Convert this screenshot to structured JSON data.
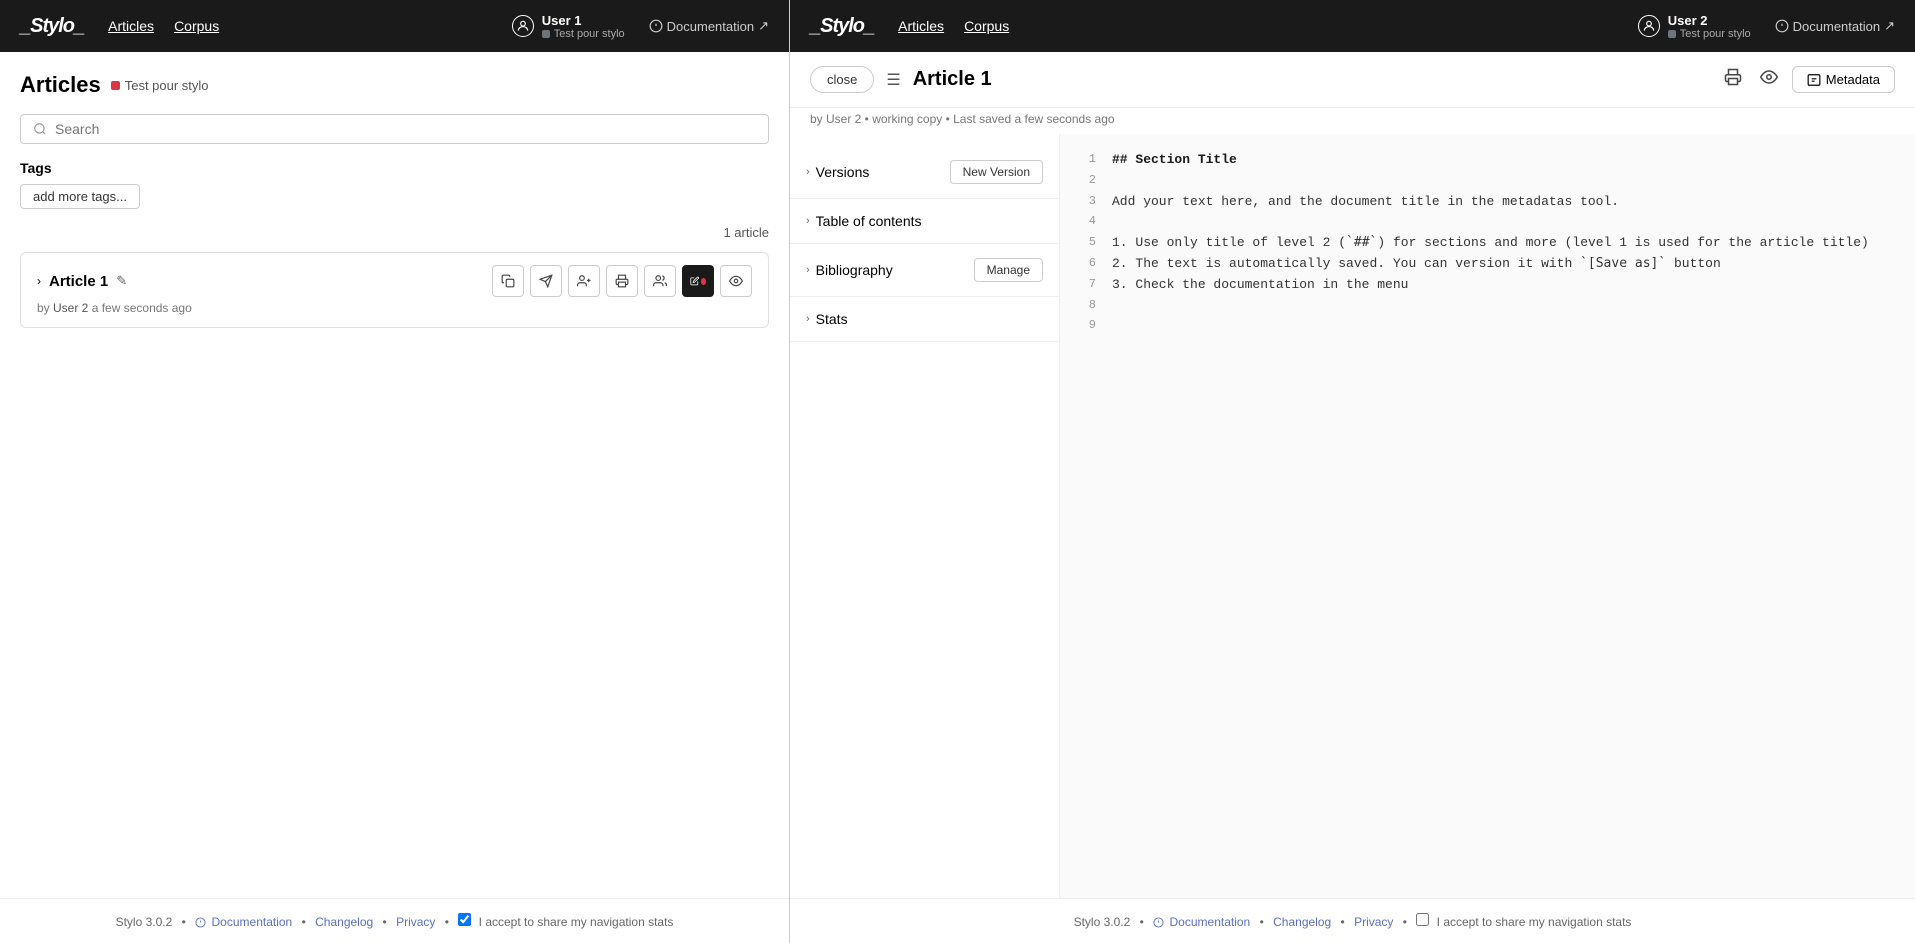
{
  "leftPanel": {
    "navbar": {
      "brand": "_Stylo_",
      "nav": [
        {
          "label": "Articles",
          "id": "articles"
        },
        {
          "label": "Corpus",
          "id": "corpus"
        }
      ],
      "user": {
        "name": "User 1",
        "corpusName": "Test pour stylo"
      },
      "documentation": "Documentation"
    },
    "pageTitle": "Articles",
    "corpusBadge": "Test pour stylo",
    "search": {
      "placeholder": "Search",
      "value": ""
    },
    "tags": {
      "label": "Tags",
      "addButton": "add more tags..."
    },
    "articleCount": "1 article",
    "articles": [
      {
        "id": "article-1",
        "title": "Article 1",
        "author": "User 2",
        "timestamp": "a few seconds ago",
        "actions": [
          {
            "id": "copy",
            "icon": "⧉",
            "label": "copy"
          },
          {
            "id": "send",
            "icon": "✈",
            "label": "send"
          },
          {
            "id": "add-user",
            "icon": "⊕",
            "label": "add user"
          },
          {
            "id": "print",
            "icon": "⎙",
            "label": "print"
          },
          {
            "id": "share",
            "icon": "👥",
            "label": "share"
          },
          {
            "id": "edit",
            "icon": "✏",
            "label": "edit",
            "active": true
          },
          {
            "id": "preview",
            "icon": "👁",
            "label": "preview"
          }
        ]
      }
    ],
    "footer": {
      "version": "Stylo 3.0.2",
      "documentation": "Documentation",
      "changelog": "Changelog",
      "privacy": "Privacy",
      "statsConsent": "I accept to share my navigation stats"
    }
  },
  "rightPanel": {
    "navbar": {
      "brand": "_Stylo_",
      "nav": [
        {
          "label": "Articles",
          "id": "articles"
        },
        {
          "label": "Corpus",
          "id": "corpus"
        }
      ],
      "user": {
        "name": "User 2",
        "corpusName": "Test pour stylo"
      },
      "documentation": "Documentation"
    },
    "editor": {
      "closeButton": "close",
      "articleTitle": "Article 1",
      "subtitle": "by User 2  •  working copy  •  Last saved a few seconds ago",
      "metadataButton": "Metadata",
      "sidebar": {
        "sections": [
          {
            "id": "versions",
            "title": "Versions",
            "actionButton": "New Version"
          },
          {
            "id": "table-of-contents",
            "title": "Table of contents",
            "actionButton": null
          },
          {
            "id": "bibliography",
            "title": "Bibliography",
            "actionButton": "Manage"
          },
          {
            "id": "stats",
            "title": "Stats",
            "actionButton": null
          }
        ]
      },
      "codeLines": [
        {
          "num": "1",
          "content": "## Section Title",
          "type": "h2"
        },
        {
          "num": "2",
          "content": "",
          "type": "empty"
        },
        {
          "num": "3",
          "content": "Add your text here, and the document title in the",
          "type": "text"
        },
        {
          "num": "",
          "content": "metadatas tool.",
          "type": "text-cont"
        },
        {
          "num": "4",
          "content": "",
          "type": "empty"
        },
        {
          "num": "5",
          "content": "1. Use only title of level 2 (`##`) for sections",
          "type": "text"
        },
        {
          "num": "",
          "content": "and more (level 1 is used for the article title)",
          "type": "text-cont"
        },
        {
          "num": "6",
          "content": "2. The text is automatically saved. You can",
          "type": "text"
        },
        {
          "num": "",
          "content": "version it with `[Save as]` button",
          "type": "text-cont"
        },
        {
          "num": "7",
          "content": "3. Check the documentation in the menu",
          "type": "text"
        },
        {
          "num": "8",
          "content": "",
          "type": "empty"
        },
        {
          "num": "9",
          "content": "",
          "type": "empty"
        }
      ]
    },
    "footer": {
      "version": "Stylo 3.0.2",
      "documentation": "Documentation",
      "changelog": "Changelog",
      "privacy": "Privacy",
      "statsConsent": "I accept to share my navigation stats"
    }
  }
}
